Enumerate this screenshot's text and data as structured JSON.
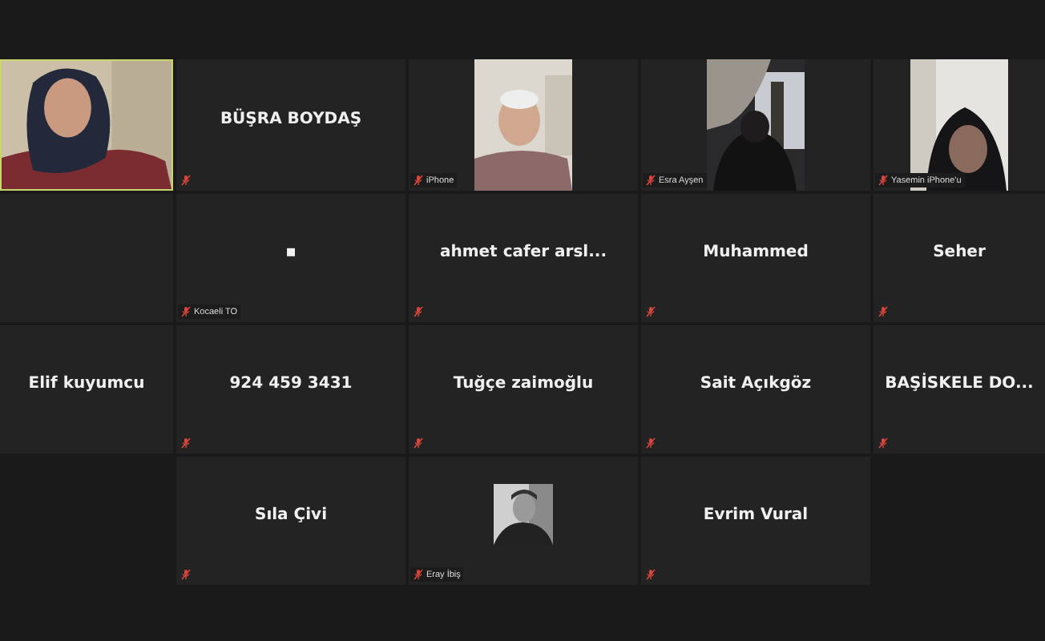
{
  "tiles": [
    {
      "kind": "video",
      "active": true,
      "muted": false
    },
    {
      "kind": "name",
      "name": "BÜŞRA BOYDAŞ",
      "muted": true,
      "active": false
    },
    {
      "kind": "portrait",
      "label": "iPhone",
      "muted": true,
      "active": false
    },
    {
      "kind": "portrait",
      "label": "Esra Ayşen",
      "muted": true,
      "active": false
    },
    {
      "kind": "portrait",
      "label": "Yasemin iPhone'u",
      "muted": true,
      "active": false
    },
    {
      "kind": "blank",
      "muted": false,
      "active": false
    },
    {
      "kind": "name",
      "name": "▪",
      "label": "Kocaeli TO",
      "muted": true,
      "active": false
    },
    {
      "kind": "name",
      "name": "ahmet cafer arsl...",
      "muted": true,
      "active": false
    },
    {
      "kind": "name",
      "name": "Muhammed",
      "muted": true,
      "active": false
    },
    {
      "kind": "name",
      "name": "Seher",
      "muted": true,
      "active": false
    },
    {
      "kind": "name",
      "name": "Elif kuyumcu",
      "muted": false,
      "active": false
    },
    {
      "kind": "name",
      "name": "924 459 3431",
      "muted": true,
      "active": false
    },
    {
      "kind": "name",
      "name": "Tuğçe zaimoğlu",
      "muted": true,
      "active": false
    },
    {
      "kind": "name",
      "name": "Sait Açıkgöz",
      "muted": true,
      "active": false
    },
    {
      "kind": "name",
      "name": "BAŞİSKELE DO...",
      "muted": true,
      "active": false
    },
    {
      "kind": "empty"
    },
    {
      "kind": "name",
      "name": "Sıla Çivi",
      "muted": true,
      "active": false
    },
    {
      "label": "Eray İbiş",
      "muted": true,
      "active": false
    },
    {
      "kind": "name",
      "name": "Evrim Vural",
      "muted": true,
      "active": false
    },
    {
      "kind": "empty"
    }
  ]
}
